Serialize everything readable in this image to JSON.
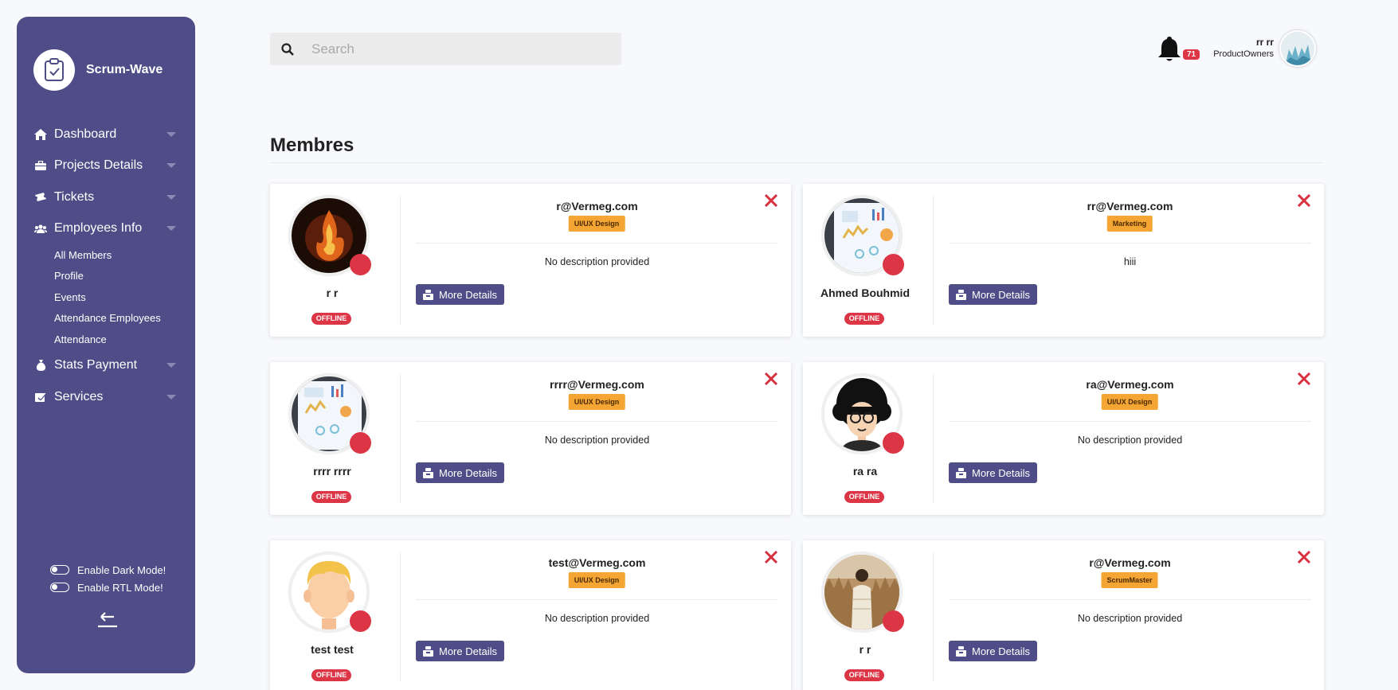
{
  "app": {
    "name": "Scrum-Wave"
  },
  "sidebar": {
    "items": [
      {
        "label": "Dashboard",
        "icon": "home-icon"
      },
      {
        "label": "Projects Details",
        "icon": "briefcase-icon"
      },
      {
        "label": "Tickets",
        "icon": "ticket-icon"
      },
      {
        "label": "Employees Info",
        "icon": "users-icon"
      }
    ],
    "subitems": [
      "All Members",
      "Profile",
      "Events",
      "Attendance Employees",
      "Attendance"
    ],
    "items2": [
      {
        "label": "Stats Payment",
        "icon": "money-bag-icon"
      },
      {
        "label": "Services",
        "icon": "services-icon"
      }
    ],
    "dark_mode_label": "Enable Dark Mode!",
    "rtl_mode_label": "Enable RTL Mode!"
  },
  "header": {
    "search_placeholder": "Search",
    "notification_count": "71",
    "user_name": "rr rr",
    "user_role": "ProductOwners"
  },
  "page": {
    "title": "Membres"
  },
  "members": [
    {
      "name": "r r",
      "email": "r@Vermeg.com",
      "role": "UI/UX Design",
      "description": "No description provided",
      "status": "OFFLINE",
      "avatar": "fire"
    },
    {
      "name": "Ahmed Bouhmid",
      "email": "rr@Vermeg.com",
      "role": "Marketing",
      "description": "hiii",
      "status": "OFFLINE",
      "avatar": "dashboard"
    },
    {
      "name": "rrrr rrrr",
      "email": "rrrr@Vermeg.com",
      "role": "UI/UX Design",
      "description": "No description provided",
      "status": "OFFLINE",
      "avatar": "dashboard"
    },
    {
      "name": "ra ra",
      "email": "ra@Vermeg.com",
      "role": "UI/UX Design",
      "description": "No description provided",
      "status": "OFFLINE",
      "avatar": "afro"
    },
    {
      "name": "test test",
      "email": "test@Vermeg.com",
      "role": "UI/UX Design",
      "description": "No description provided",
      "status": "OFFLINE",
      "avatar": "blond"
    },
    {
      "name": "r r",
      "email": "r@Vermeg.com",
      "role": "ScrumMaster",
      "description": "No description provided",
      "status": "OFFLINE",
      "avatar": "field"
    }
  ],
  "labels": {
    "more_details": "More Details"
  },
  "colors": {
    "sidebar": "#4e4d87",
    "badge": "#f4a533",
    "offline": "#dc3545",
    "close": "#d9303f"
  }
}
